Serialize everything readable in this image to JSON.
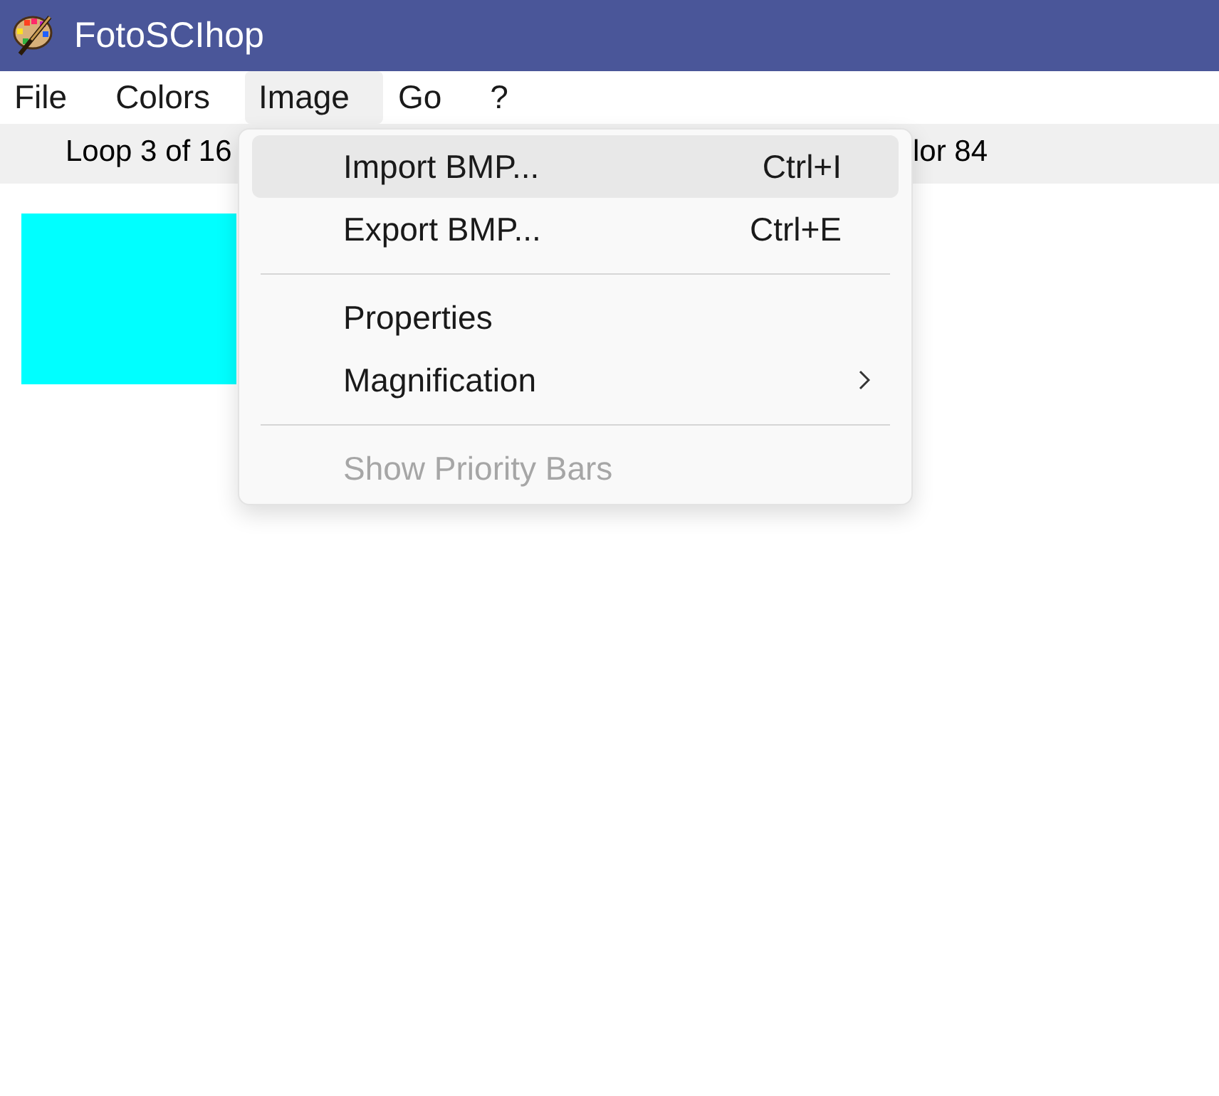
{
  "window": {
    "title": "FotoSCIhop"
  },
  "menu_bar": [
    {
      "label": "File",
      "selected": false
    },
    {
      "label": "Colors",
      "selected": false
    },
    {
      "label": "Image",
      "selected": true
    },
    {
      "label": "Go",
      "selected": false
    },
    {
      "label": "?",
      "selected": false
    }
  ],
  "status_bar": [
    "Loop 3 of 16",
    "lor 84"
  ],
  "dropdown": {
    "items": [
      {
        "kind": "item",
        "label": "Import BMP...",
        "shortcut": "Ctrl+I",
        "selected": true,
        "disabled": false
      },
      {
        "kind": "item",
        "label": "Export BMP...",
        "shortcut": "Ctrl+E",
        "selected": false,
        "disabled": false
      },
      {
        "kind": "separator"
      },
      {
        "kind": "item",
        "label": "Properties",
        "selected": false,
        "disabled": false
      },
      {
        "kind": "submenu",
        "label": "Magnification",
        "selected": false,
        "disabled": false
      },
      {
        "kind": "separator"
      },
      {
        "kind": "item",
        "label": "Show Priority Bars",
        "selected": false,
        "disabled": true
      }
    ]
  }
}
